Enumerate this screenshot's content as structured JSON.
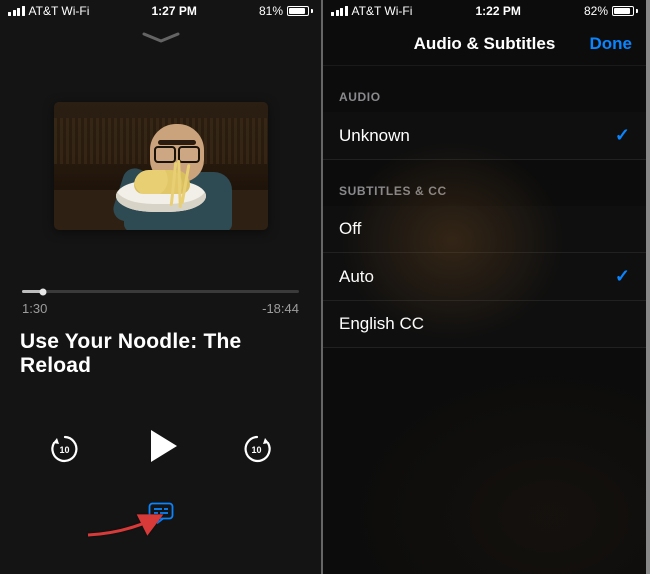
{
  "left": {
    "status": {
      "carrier": "AT&T Wi-Fi",
      "time": "1:27 PM",
      "battery_pct": "81%",
      "battery_fill": 81
    },
    "scrubber": {
      "elapsed": "1:30",
      "remaining": "-18:44",
      "progress_pct": 7.5
    },
    "title": "Use Your Noodle: The Reload",
    "controls": {
      "back_seconds": "10",
      "forward_seconds": "10"
    }
  },
  "right": {
    "status": {
      "carrier": "AT&T Wi-Fi",
      "time": "1:22 PM",
      "battery_pct": "82%",
      "battery_fill": 82
    },
    "nav": {
      "title": "Audio & Subtitles",
      "done": "Done"
    },
    "sections": {
      "audio_header": "AUDIO",
      "audio_items": [
        {
          "label": "Unknown",
          "selected": true
        }
      ],
      "subs_header": "SUBTITLES & CC",
      "subs_items": [
        {
          "label": "Off",
          "selected": false
        },
        {
          "label": "Auto",
          "selected": true
        },
        {
          "label": "English CC",
          "selected": false
        }
      ]
    }
  }
}
